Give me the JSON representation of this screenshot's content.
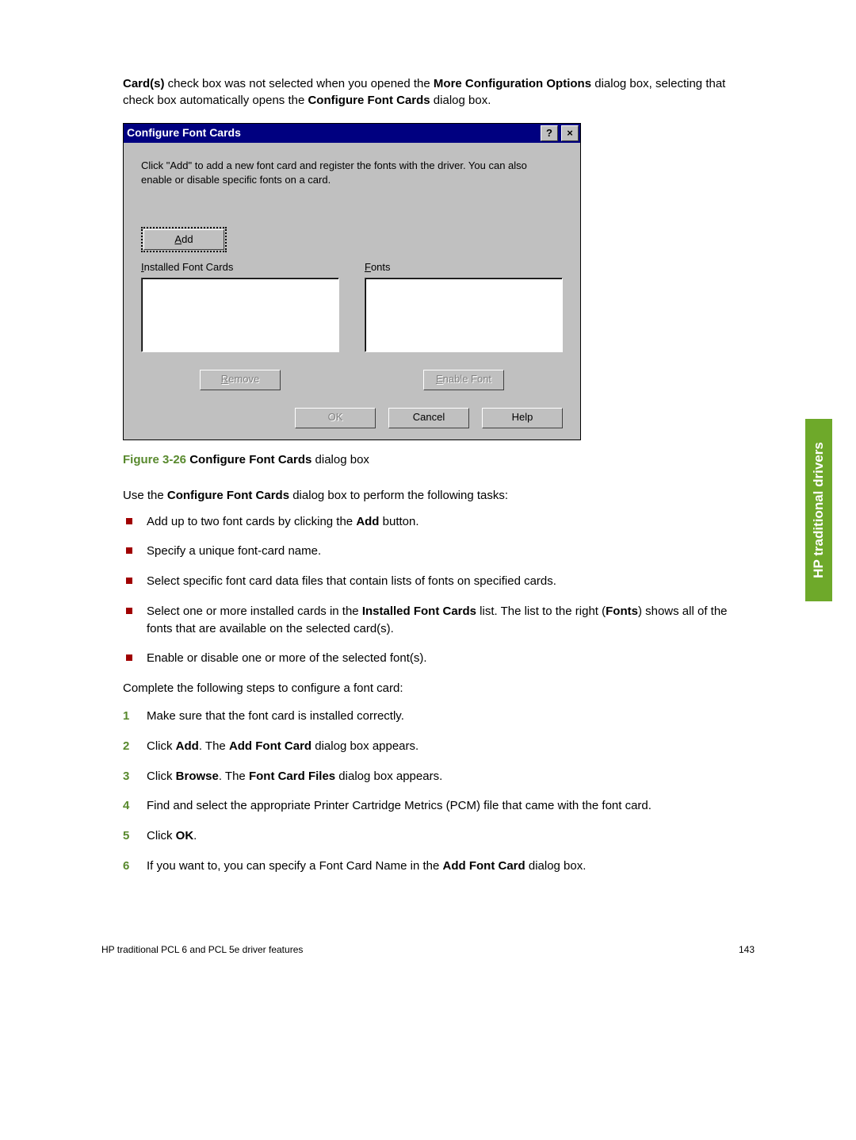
{
  "intro": {
    "seg1": "Card(s)",
    "seg2": " check box was not selected when you opened the ",
    "seg3": "More Configuration Options",
    "seg4": " dialog box, selecting that check box automatically opens the ",
    "seg5": "Configure Font Cards",
    "seg6": " dialog box."
  },
  "dialog": {
    "title": "Configure Font Cards",
    "help_btn": "?",
    "close_btn": "×",
    "description": "Click \"Add\" to add a new font card and register the fonts with the driver.  You can also enable or disable specific fonts on a card.",
    "add_label": "Add",
    "installed_label": "Installed Font Cards",
    "fonts_label": "Fonts",
    "remove_label": "Remove",
    "enable_label": "Enable Font",
    "ok_label": "OK",
    "cancel_label": "Cancel",
    "help_label": "Help"
  },
  "caption": {
    "prefix": "Figure 3-26   ",
    "bold": "Configure Font Cards",
    "rest": " dialog box"
  },
  "tasks_lead": {
    "seg1": "Use the ",
    "seg2": "Configure Font Cards",
    "seg3": " dialog box to perform the following tasks:"
  },
  "bullets": [
    {
      "seg1": "Add up to two font cards by clicking the ",
      "seg2": "Add",
      "seg3": " button."
    },
    {
      "seg1": "Specify a unique font-card name."
    },
    {
      "seg1": "Select specific font card data files that contain lists of fonts on specified cards."
    },
    {
      "seg1": "Select one or more installed cards in the ",
      "seg2": "Installed Font Cards",
      "seg3": " list. The list to the right (",
      "seg4": "Fonts",
      "seg5": ") shows all of the fonts that are available on the selected card(s)."
    },
    {
      "seg1": "Enable or disable one or more of the selected font(s)."
    }
  ],
  "steps_lead": "Complete the following steps to configure a font card:",
  "steps": [
    {
      "seg1": "Make sure that the font card is installed correctly."
    },
    {
      "seg1": "Click ",
      "seg2": "Add",
      "seg3": ". The ",
      "seg4": "Add Font Card",
      "seg5": " dialog box appears."
    },
    {
      "seg1": "Click ",
      "seg2": "Browse",
      "seg3": ". The ",
      "seg4": "Font Card Files",
      "seg5": " dialog box appears."
    },
    {
      "seg1": "Find and select the appropriate Printer Cartridge Metrics (PCM) file that came with the font card."
    },
    {
      "seg1": "Click ",
      "seg2": "OK",
      "seg3": "."
    },
    {
      "seg1": "If you want to, you can specify a Font Card Name in the ",
      "seg2": "Add Font Card",
      "seg3": " dialog box."
    }
  ],
  "side_tab": "HP traditional drivers",
  "footer_left": "HP traditional PCL 6 and PCL 5e driver features",
  "footer_right": "143"
}
